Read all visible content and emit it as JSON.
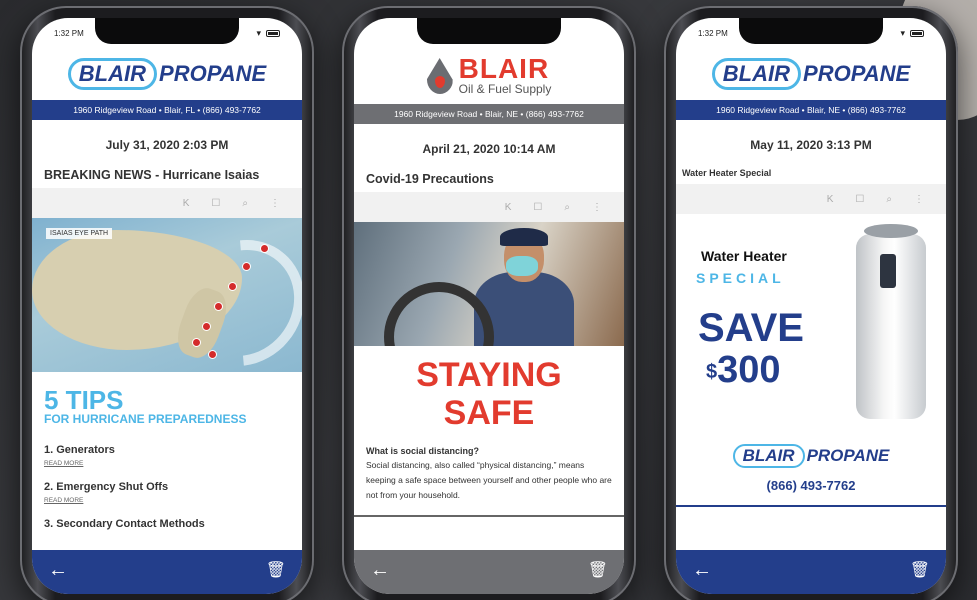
{
  "colors": {
    "blair_blue": "#233e8b",
    "light_blue": "#4db6e6",
    "oil_red": "#e23b2e",
    "gray_bar": "#6e6f73"
  },
  "phones": [
    {
      "time": "1:32 PM",
      "logo": {
        "name": "BLAIR",
        "sub": "PROPANE"
      },
      "address": "1960 Ridgeview Road  •  Blair, FL  •  (866) 493-7762",
      "date": "July 31, 2020 2:03 PM",
      "headline": "BREAKING NEWS - Hurricane Isaias",
      "map_label": "ISAIAS EYE PATH",
      "tips_title": "5 TIPS",
      "tips_sub": "FOR HURRICANE PREPAREDNESS",
      "tips": [
        "1. Generators",
        "2. Emergency Shut Offs",
        "3. Secondary Contact Methods"
      ],
      "read_more": "READ MORE"
    },
    {
      "logo": {
        "name": "BLAIR",
        "sub": "Oil & Fuel Supply"
      },
      "address": "1960 Ridgeview Road  •  Blair, NE  •  (866) 493-7762",
      "date": "April 21, 2020 10:14 AM",
      "headline": "Covid-19 Precautions",
      "big1": "STAYING",
      "big2": "SAFE",
      "question": "What is social distancing?",
      "body": "Social distancing, also called “physical distancing,” means keeping a safe space between yourself and other people who are not from your household."
    },
    {
      "time": "1:32 PM",
      "logo": {
        "name": "BLAIR",
        "sub": "PROPANE"
      },
      "address": "1960 Ridgeview Road  •  Blair, NE  •  (866) 493-7762",
      "date": "May 11, 2020 3:13 PM",
      "headline": "Water Heater Special",
      "wh_title": "Water Heater",
      "wh_special": "SPECIAL",
      "wh_save": "SAVE",
      "wh_currency": "$",
      "wh_amount": "300",
      "phone": "(866) 493-7762"
    }
  ],
  "icons": {
    "back": "←",
    "trash": "🗑",
    "toolbar": [
      "K",
      "☐",
      "⌕",
      "⋮"
    ]
  }
}
